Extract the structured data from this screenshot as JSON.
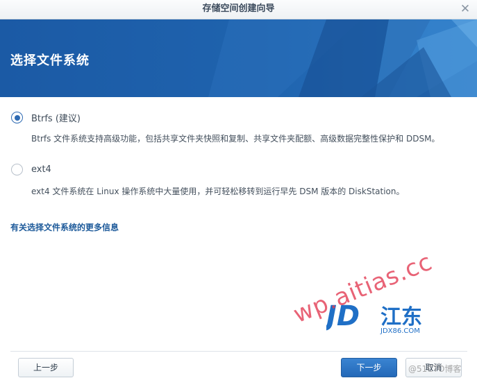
{
  "window": {
    "title": "存储空间创建向导",
    "close_symbol": "✕"
  },
  "banner": {
    "title": "选择文件系统"
  },
  "options": [
    {
      "label": "Btrfs (建议)",
      "selected": true,
      "description": "Btrfs 文件系统支持高级功能，包括共享文件夹快照和复制、共享文件夹配额、高级数据完整性保护和 DDSM。"
    },
    {
      "label": "ext4",
      "selected": false,
      "description": "ext4 文件系统在 Linux 操作系统中大量使用，并可轻松移转到运行早先 DSM 版本的 DiskStation。"
    }
  ],
  "more_info_link": "有关选择文件系统的更多信息",
  "buttons": {
    "prev": "上一步",
    "next": "下一步",
    "cancel": "取消"
  },
  "watermark": {
    "text": "wp.aitias.cc",
    "logo_letters": "JD",
    "logo_cn": "江东",
    "logo_sub": "JDX86.COM",
    "credit": "@51CTO博客"
  },
  "colors": {
    "banner": "#1f5fa9",
    "accent": "#2f6bb3",
    "link": "#1d5a9a",
    "primary_button": "#2368b8"
  }
}
